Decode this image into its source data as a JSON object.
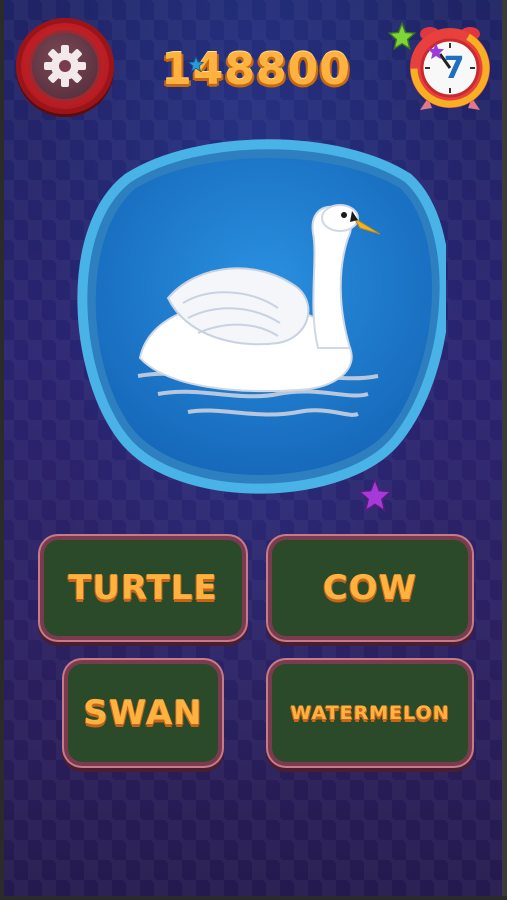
{
  "header": {
    "score": "148800",
    "settings_icon": "gear-icon",
    "timer_icon": "alarm-clock-icon",
    "timer_value": "7"
  },
  "question": {
    "image_subject": "swan-illustration"
  },
  "answers": [
    {
      "label": "TURTLE"
    },
    {
      "label": "COW"
    },
    {
      "label": "SWAN"
    },
    {
      "label": "WATERMELON"
    }
  ],
  "colors": {
    "answer_text": "#ffb23f",
    "answer_bg": "#2a4a2a",
    "answer_border": "#7a3b4e",
    "card_blue": "#1f7fd0",
    "card_border": "#3aa6dc",
    "settings_red": "#d8262c"
  }
}
